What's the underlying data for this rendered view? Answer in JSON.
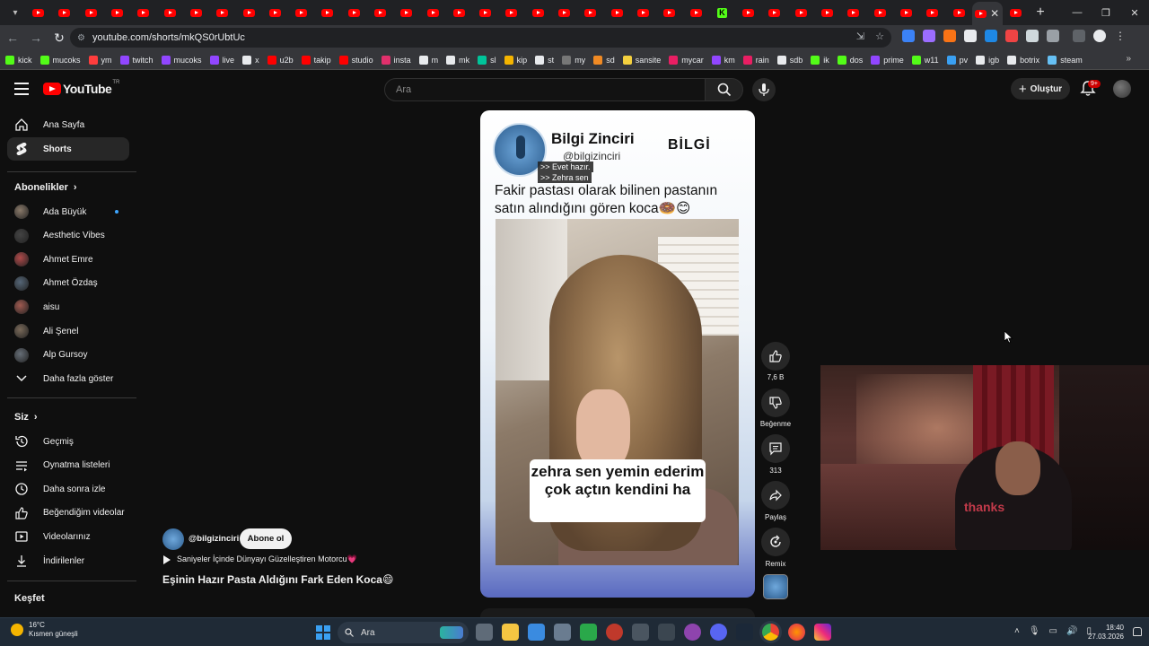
{
  "browser": {
    "url": "youtube.com/shorts/mkQS0rUbtUc",
    "new_tab_symbol": "+",
    "close_tab_symbol": "✕"
  },
  "bookmarks": [
    {
      "label": "kick",
      "color": "#53fc18"
    },
    {
      "label": "mucoks",
      "color": "#53fc18"
    },
    {
      "label": "ym",
      "color": "#ff3d3d"
    },
    {
      "label": "twitch",
      "color": "#9146ff"
    },
    {
      "label": "mucoks",
      "color": "#9146ff"
    },
    {
      "label": "live",
      "color": "#9146ff"
    },
    {
      "label": "x",
      "color": "#e8eaed"
    },
    {
      "label": "u2b",
      "color": "#ff0000"
    },
    {
      "label": "takip",
      "color": "#ff0000"
    },
    {
      "label": "studio",
      "color": "#ff0000"
    },
    {
      "label": "insta",
      "color": "#e1306c"
    },
    {
      "label": "m",
      "color": "#e8eaed"
    },
    {
      "label": "mk",
      "color": "#e8eaed"
    },
    {
      "label": "sl",
      "color": "#00c49a"
    },
    {
      "label": "kip",
      "color": "#f4b400"
    },
    {
      "label": "st",
      "color": "#e8eaed"
    },
    {
      "label": "my",
      "color": "#777777"
    },
    {
      "label": "sd",
      "color": "#f08a24"
    },
    {
      "label": "sansite",
      "color": "#f4d03f"
    },
    {
      "label": "mycar",
      "color": "#e91e63"
    },
    {
      "label": "km",
      "color": "#9146ff"
    },
    {
      "label": "rain",
      "color": "#e91e63"
    },
    {
      "label": "sdb",
      "color": "#e8eaed"
    },
    {
      "label": "ik",
      "color": "#53fc18"
    },
    {
      "label": "dos",
      "color": "#53fc18"
    },
    {
      "label": "prime",
      "color": "#9146ff"
    },
    {
      "label": "w11",
      "color": "#53fc18"
    },
    {
      "label": "pv",
      "color": "#3aa0f2"
    },
    {
      "label": "igb",
      "color": "#e8eaed"
    },
    {
      "label": "botrix",
      "color": "#e8eaed"
    },
    {
      "label": "steam",
      "color": "#66c0f4"
    }
  ],
  "header": {
    "logo_text": "YouTube",
    "logo_sup": "TR",
    "search_placeholder": "Ara",
    "create_label": "Oluştur",
    "notif_badge": "9+"
  },
  "sidebar": {
    "main": [
      {
        "label": "Ana Sayfa",
        "icon": "home-icon"
      },
      {
        "label": "Shorts",
        "icon": "shorts-icon"
      }
    ],
    "subs_heading": "Abonelikler",
    "subs": [
      {
        "label": "Ada Büyük",
        "color": "#8a7a6a",
        "new": true
      },
      {
        "label": "Aesthetic Vibes",
        "color": "#444444"
      },
      {
        "label": "Ahmet Emre",
        "color": "#b04a4a"
      },
      {
        "label": "Ahmet Özdaş",
        "color": "#556677"
      },
      {
        "label": "aisu",
        "color": "#a05a50"
      },
      {
        "label": "Ali Şenel",
        "color": "#7a6a5a"
      },
      {
        "label": "Alp Gursoy",
        "color": "#666e77"
      }
    ],
    "show_more": "Daha fazla göster",
    "you_heading": "Siz",
    "you": [
      {
        "label": "Geçmiş",
        "icon": "history-icon"
      },
      {
        "label": "Oynatma listeleri",
        "icon": "playlist-icon"
      },
      {
        "label": "Daha sonra izle",
        "icon": "clock-icon"
      },
      {
        "label": "Beğendiğim videolar",
        "icon": "like-icon"
      },
      {
        "label": "Videolarınız",
        "icon": "videos-icon"
      },
      {
        "label": "İndirilenler",
        "icon": "download-icon"
      }
    ],
    "explore_heading": "Keşfet"
  },
  "short": {
    "channel_name": "Bilgi Zinciri",
    "channel_handle": "@bilgizinciri",
    "badge": "BİLGİ",
    "caption_1": ">> Evet hazır.",
    "caption_2": ">> Zehra sen",
    "headline": "Fakir pastası olarak bilinen pastanın satın alındığını gören koca🍩😊",
    "subtitle": "zehra sen yemin ederim çok açtın kendini ha",
    "likes": "7,6 B",
    "dislike_label": "Beğenme",
    "comments": "313",
    "share_label": "Paylaş",
    "remix_label": "Remix",
    "info_handle": "@bilgizinciri",
    "subscribe_label": "Abone ol",
    "music": "Saniyeler İçinde Dünyayı Güzelleştiren Motorcu💗",
    "title": "Eşinin Hazır Pasta Aldığını Fark Eden Koca😄"
  },
  "webcam": {
    "shirt_text": "thanks"
  },
  "taskbar": {
    "temp": "16°C",
    "weather": "Kısmen güneşli",
    "search_placeholder": "Ara",
    "time": "18:40",
    "date": "27.03.2026"
  }
}
